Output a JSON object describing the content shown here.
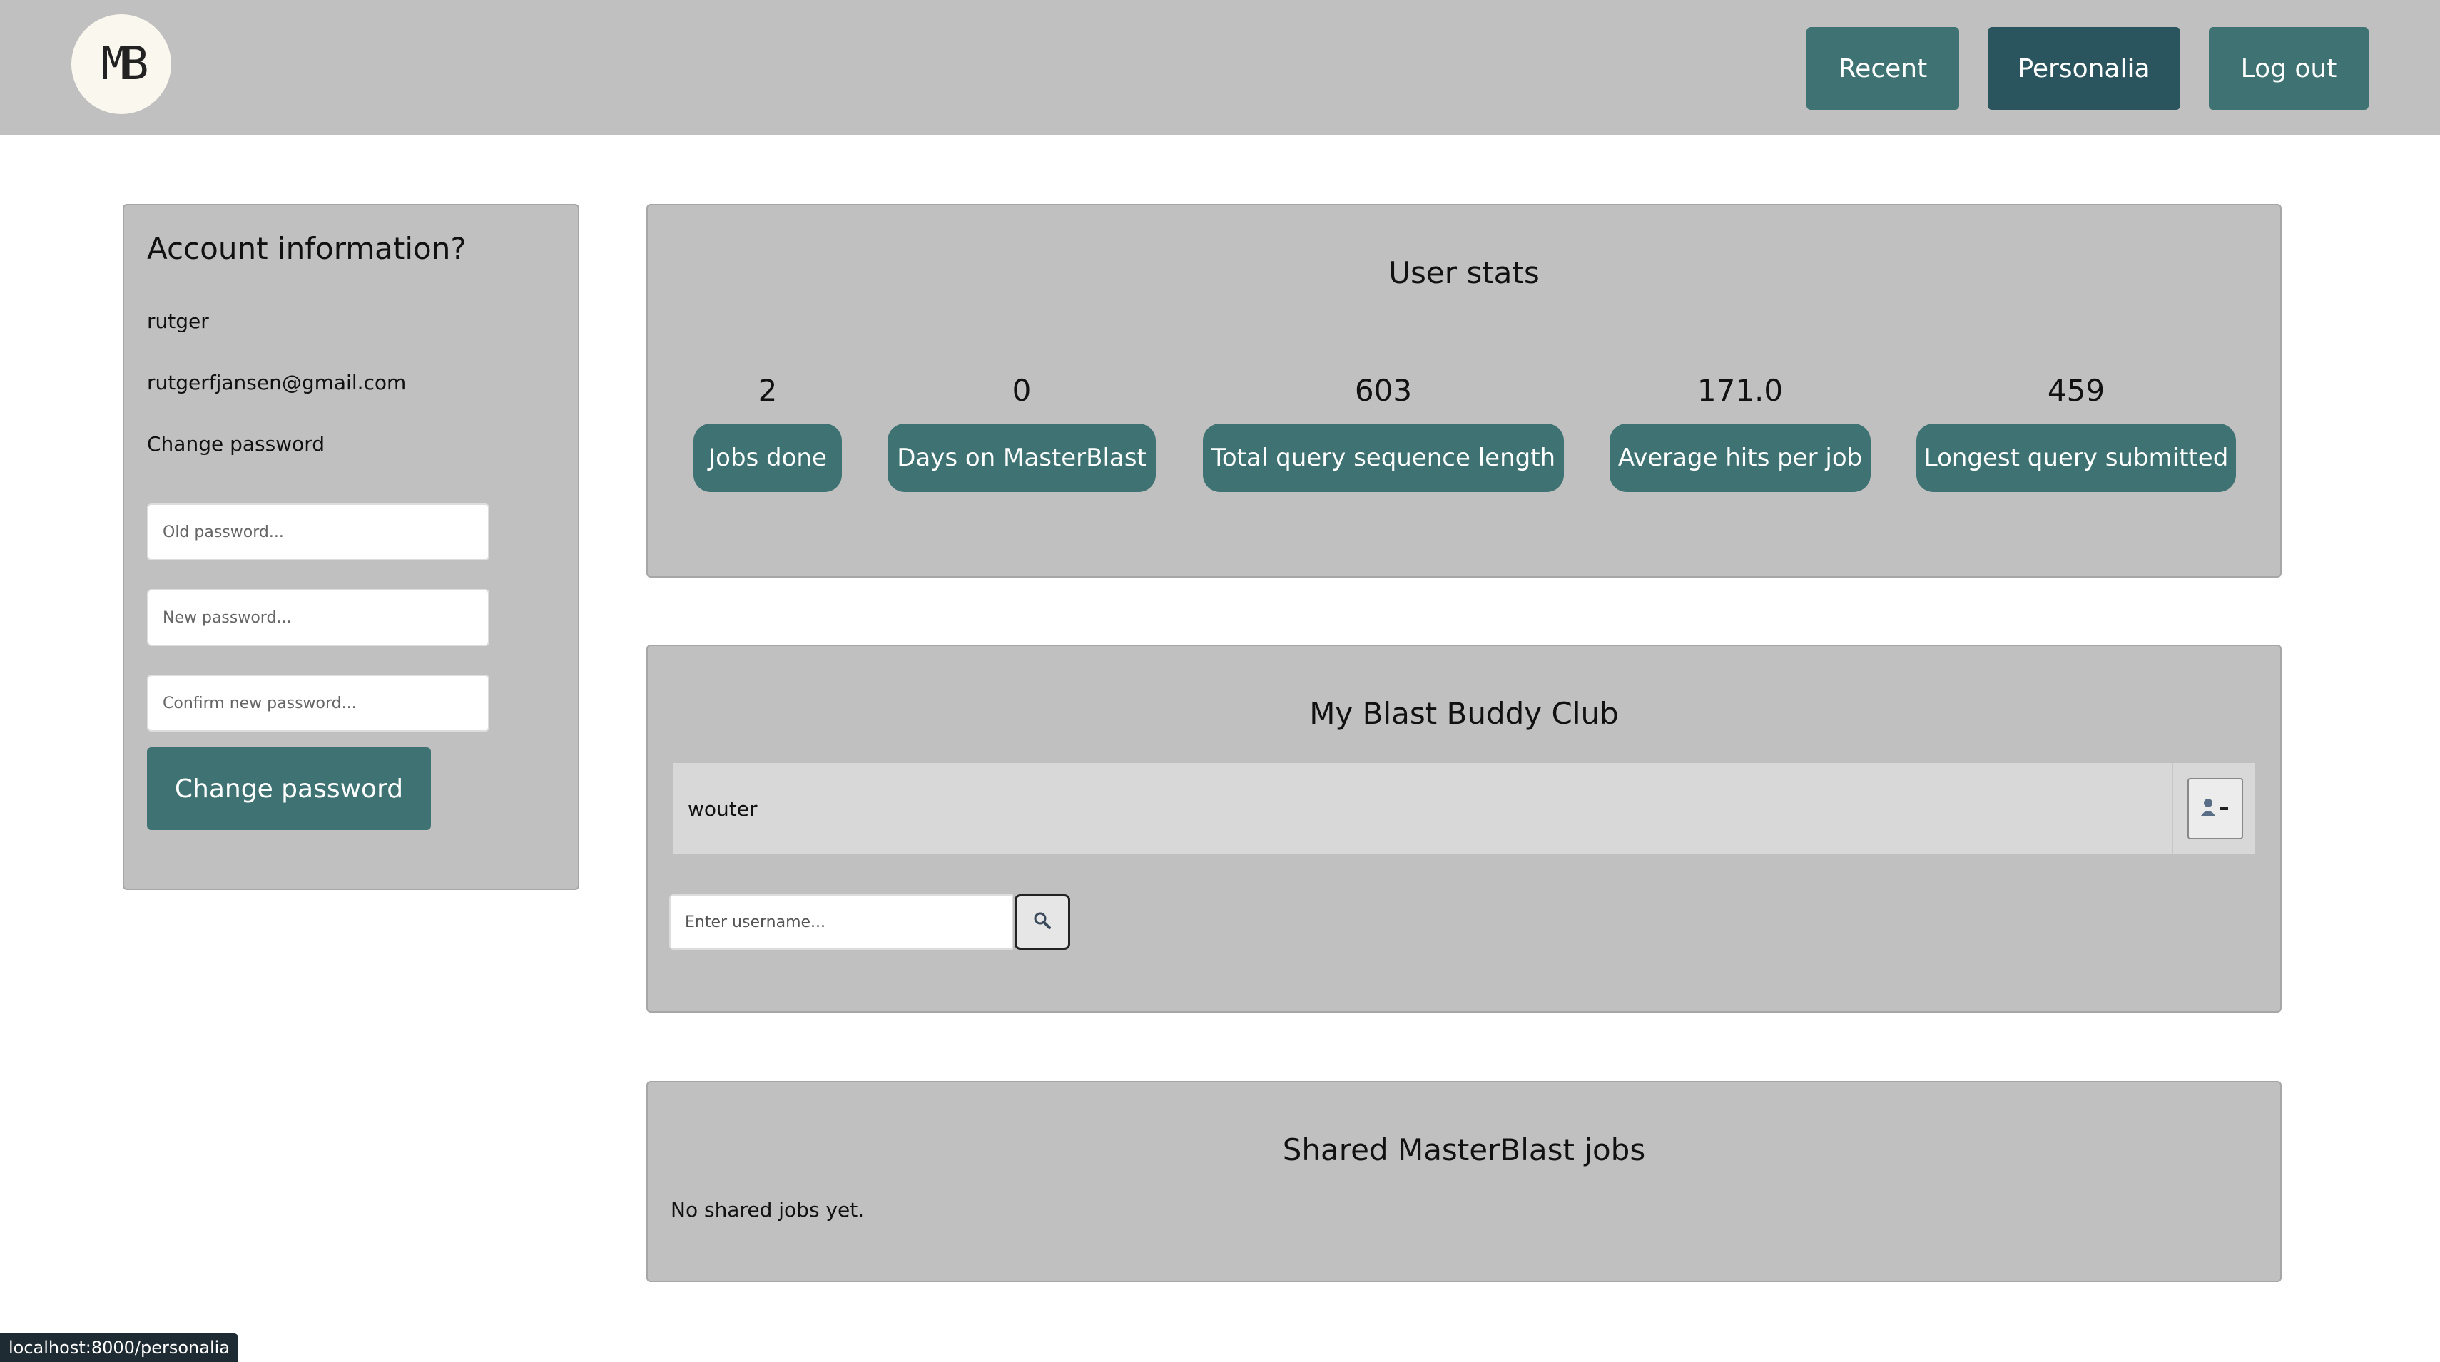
{
  "header": {
    "logo_text": "MB",
    "nav": [
      {
        "label": "Recent"
      },
      {
        "label": "Personalia"
      },
      {
        "label": "Log out"
      }
    ]
  },
  "account": {
    "title": "Account information?",
    "username": "rutger",
    "email": "rutgerfjansen@gmail.com",
    "change_password_heading": "Change password",
    "old_password_placeholder": "Old password...",
    "new_password_placeholder": "New password...",
    "confirm_password_placeholder": "Confirm new password...",
    "change_password_button": "Change password"
  },
  "user_stats": {
    "title": "User stats",
    "items": [
      {
        "value": "2",
        "label": "Jobs done"
      },
      {
        "value": "0",
        "label": "Days on MasterBlast"
      },
      {
        "value": "603",
        "label": "Total query sequence length"
      },
      {
        "value": "171.0",
        "label": "Average hits per job"
      },
      {
        "value": "459",
        "label": "Longest query submitted"
      }
    ]
  },
  "buddy_club": {
    "title": "My Blast Buddy Club",
    "buddies": [
      {
        "name": "wouter"
      }
    ],
    "search_placeholder": "Enter username..."
  },
  "shared_jobs": {
    "title": "Shared MasterBlast jobs",
    "empty_text": "No shared jobs yet."
  },
  "status_bar": {
    "url": "localhost:8000/personalia"
  },
  "colors": {
    "primary": "#3f7373",
    "primary_active": "#2a555e",
    "panel": "#c0c0c0",
    "header": "#c0c0c0"
  }
}
